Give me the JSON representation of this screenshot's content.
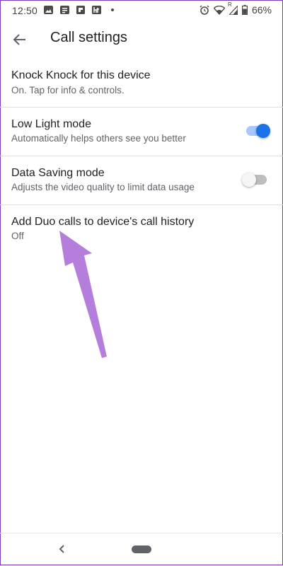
{
  "status_bar": {
    "time": "12:50",
    "battery": "66%",
    "network_tag": "R"
  },
  "appbar": {
    "title": "Call settings"
  },
  "settings": [
    {
      "title": "Knock Knock for this device",
      "subtitle": "On. Tap for info & controls."
    },
    {
      "title": "Low Light mode",
      "subtitle": "Automatically helps others see you better",
      "toggle": true
    },
    {
      "title": "Data Saving mode",
      "subtitle": "Adjusts the video quality to limit data usage",
      "toggle": false
    },
    {
      "title": "Add Duo calls to device's call history",
      "subtitle": "Off"
    }
  ],
  "colors": {
    "accent": "#1a73e8",
    "annotation_arrow": "#b57edc"
  }
}
